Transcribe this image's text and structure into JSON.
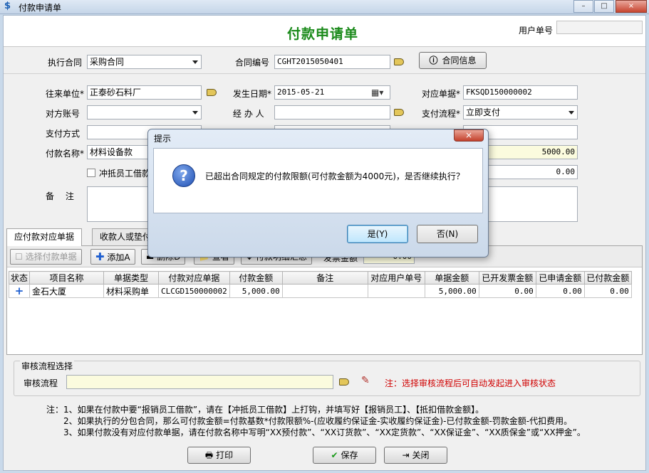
{
  "window": {
    "title": "付款申请单",
    "controls": [
      "–",
      "□",
      "×"
    ]
  },
  "header": {
    "form_title": "付款申请单",
    "user_no_label": "用户单号",
    "user_no_value": ""
  },
  "contract": {
    "exec_label": "执行合同",
    "exec_value": "采购合同",
    "no_label": "合同编号",
    "no_value": "CGHT2015050401",
    "info_button": "合同信息"
  },
  "form": {
    "partner_label": "往来单位*",
    "partner_value": "正泰砂石料厂",
    "date_label": "发生日期*",
    "date_value": "2015-05-21",
    "ref_label": "对应单据*",
    "ref_value": "FKSQD150000002",
    "account_label": "对方账号",
    "account_value": "",
    "handler_label": "经 办 人",
    "handler_value": "",
    "flow_label": "支付流程*",
    "flow_value": "立即支付",
    "pay_method_label": "支付方式",
    "pay_method_value": "",
    "pay_name_label": "付款名称*",
    "pay_name_value": "材料设备款",
    "amount_value": "5000.00",
    "offset_label": "冲抵员工借款",
    "offset_amount_value": "0.00",
    "remark_label": "备　 注",
    "remark_value": ""
  },
  "tabs": [
    {
      "label": "应付款对应单据",
      "active": true
    },
    {
      "label": "收款人或垫付",
      "active": false
    }
  ],
  "toolbar": {
    "select_doc": "选择付款单据",
    "add": "添加A",
    "delete": "删除D",
    "view": "查看",
    "detail": "付款明细汇总",
    "invoice_label": "发票金额",
    "invoice_value": "0.00"
  },
  "grid": {
    "columns": [
      "状态",
      "项目名称",
      "单据类型",
      "付款对应单据",
      "付款金额",
      "备注",
      "对应用户单号",
      "单据金额",
      "已开发票金额",
      "已申请金额",
      "已付款金额"
    ],
    "rows": [
      {
        "status": "+",
        "project": "金石大厦",
        "doc_type": "材料采购单",
        "doc_no": "CLCGD150000002",
        "pay_amount": "5,000.00",
        "remark": "",
        "user_no": "",
        "doc_amount": "5,000.00",
        "invoiced": "0.00",
        "applied": "0.00",
        "paid": "0.00"
      }
    ]
  },
  "audit": {
    "section_title": "审核流程选择",
    "label": "审核流程",
    "value": "",
    "hint": "注：选择审核流程后可自动发起进入审核状态"
  },
  "notes": [
    "注：1、如果在付款中要“报销员工借款”，请在【冲抵员工借款】上打钩，并填写好【报销员工】、【抵扣借款金额】。",
    "2、如果执行的分包合同，那么可付款金额=付款基数*付款限额%-(应收履约保证金-实收履约保证金)-已付款金额-罚款金额-代扣费用。",
    "3、如果付款没有对应付款单据，请在付款名称中写明“XX预付款”、“XX订货款”、“XX定货款”、“XX保证金”、“XX质保金”或“XX押金”。"
  ],
  "footer": {
    "print": "打印",
    "save": "保存",
    "close": "关闭"
  },
  "dialog": {
    "title": "提示",
    "close": "×",
    "message": "已超出合同规定的付款限额(可付款金额为4000元)，是否继续执行？",
    "yes": "是(Y)",
    "no": "否(N)"
  },
  "colors": {
    "title_green": "#1a8a1a",
    "hint_red": "#d00000",
    "field_yellow": "#fbfbde"
  }
}
